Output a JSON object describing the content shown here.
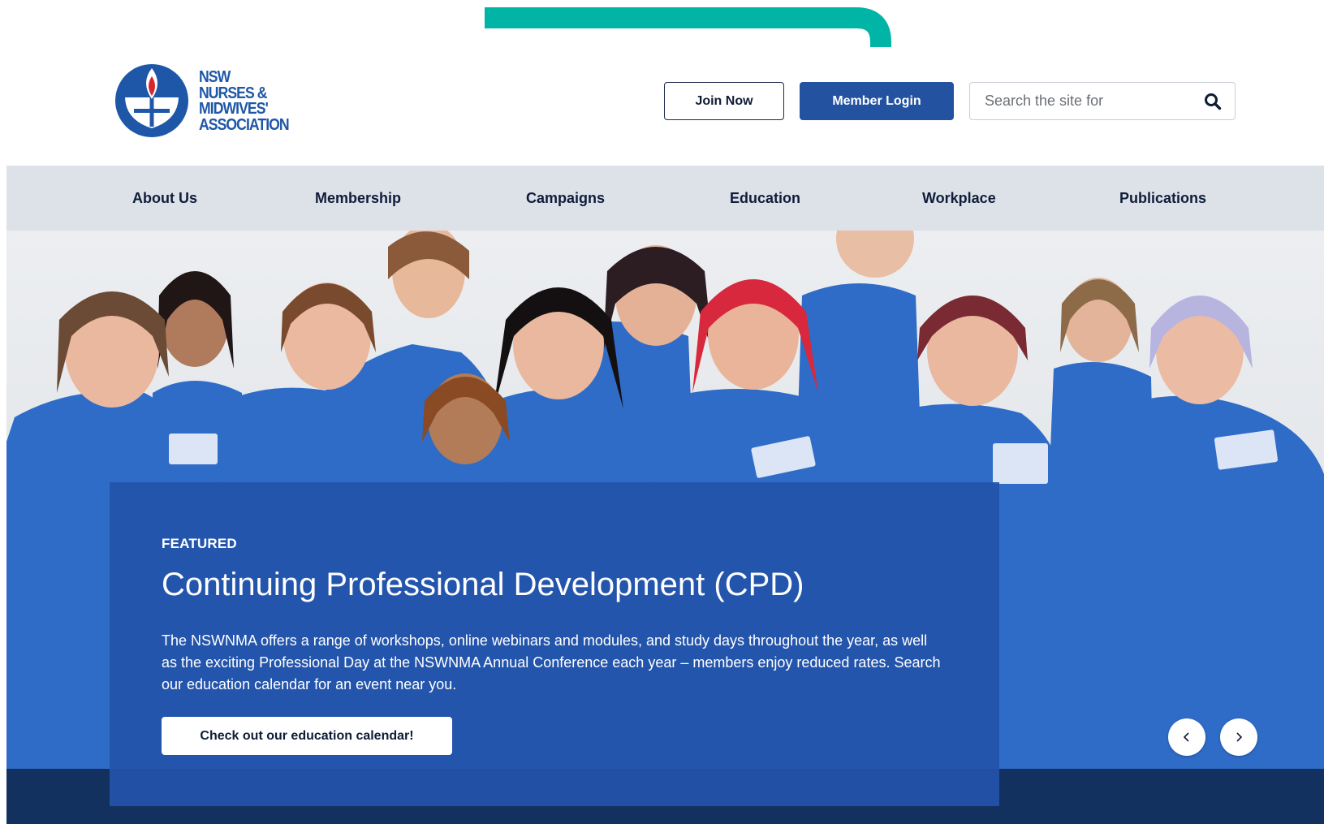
{
  "header": {
    "logo_lines": [
      "NSW",
      "NURSES &",
      "MIDWIVES'",
      "ASSOCIATION"
    ],
    "join_label": "Join Now",
    "login_label": "Member Login",
    "search_placeholder": "Search the site for",
    "search_icon": "search-icon"
  },
  "nav": {
    "items": [
      {
        "label": "About Us"
      },
      {
        "label": "Membership"
      },
      {
        "label": "Campaigns"
      },
      {
        "label": "Education"
      },
      {
        "label": "Workplace"
      },
      {
        "label": "Publications"
      }
    ]
  },
  "feature": {
    "eyebrow": "FEATURED",
    "title": "Continuing Professional Development (CPD)",
    "description": "The NSWNMA offers a range of workshops, online webinars and modules, and study days throughout the year, as well as the exciting Professional Day at the NSWNMA Annual Conference each year – members enjoy reduced rates. Search our education calendar for an event near you.",
    "cta_label": "Check out our education calendar!"
  },
  "carousel": {
    "prev_icon": "chevron-left-icon",
    "next_icon": "chevron-right-icon"
  },
  "colors": {
    "brand_blue": "#2353a0",
    "nav_background": "#dde1e8",
    "dark_navy": "#13315e",
    "annotation_teal": "#00b5a6",
    "scrub_blue": "#2f6cc8"
  }
}
